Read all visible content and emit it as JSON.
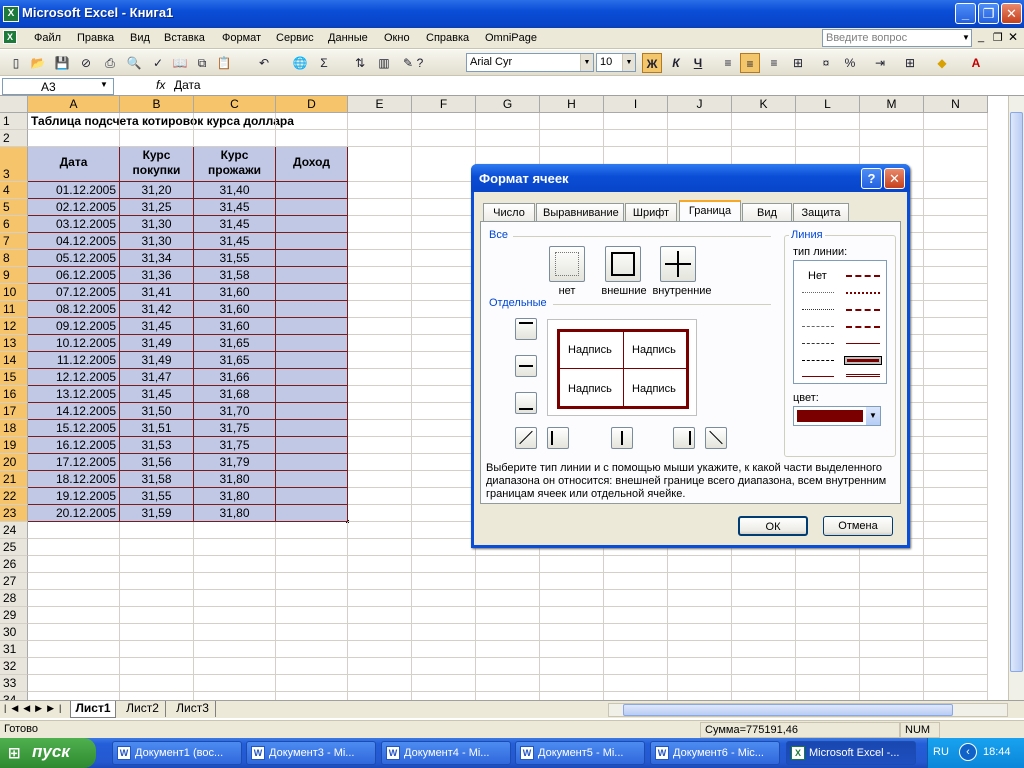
{
  "window": {
    "title": "Microsoft Excel - Книга1",
    "app_icon": "excel-icon"
  },
  "menu": {
    "items": [
      "Файл",
      "Правка",
      "Вид",
      "Вставка",
      "Формат",
      "Сервис",
      "Данные",
      "Окно",
      "Справка",
      "OmniPage"
    ],
    "ask_placeholder": "Введите вопрос"
  },
  "toolbar": {
    "font_name": "Arial Cyr",
    "font_size": "10",
    "bold_label": "Ж",
    "italic_label": "К",
    "underline_label": "Ч",
    "sum_label": "Σ",
    "percent_label": "%"
  },
  "formula_bar": {
    "name_box": "A3",
    "fx": "fx",
    "content": "Дата"
  },
  "columns": [
    "A",
    "B",
    "C",
    "D",
    "E",
    "F",
    "G",
    "H",
    "I",
    "J",
    "K",
    "L",
    "M",
    "N"
  ],
  "sheet": {
    "title_cell": "Таблица подсчета котировок курса доллара",
    "headers": [
      "Дата",
      "Курс покупки",
      "Курс прожажи",
      "Доход"
    ],
    "rows": [
      [
        "01.12.2005",
        "31,20",
        "31,40"
      ],
      [
        "02.12.2005",
        "31,25",
        "31,45"
      ],
      [
        "03.12.2005",
        "31,30",
        "31,45"
      ],
      [
        "04.12.2005",
        "31,30",
        "31,45"
      ],
      [
        "05.12.2005",
        "31,34",
        "31,55"
      ],
      [
        "06.12.2005",
        "31,36",
        "31,58"
      ],
      [
        "07.12.2005",
        "31,41",
        "31,60"
      ],
      [
        "08.12.2005",
        "31,42",
        "31,60"
      ],
      [
        "09.12.2005",
        "31,45",
        "31,60"
      ],
      [
        "10.12.2005",
        "31,49",
        "31,65"
      ],
      [
        "11.12.2005",
        "31,49",
        "31,65"
      ],
      [
        "12.12.2005",
        "31,47",
        "31,66"
      ],
      [
        "13.12.2005",
        "31,45",
        "31,68"
      ],
      [
        "14.12.2005",
        "31,50",
        "31,70"
      ],
      [
        "15.12.2005",
        "31,51",
        "31,75"
      ],
      [
        "16.12.2005",
        "31,53",
        "31,75"
      ],
      [
        "17.12.2005",
        "31,56",
        "31,79"
      ],
      [
        "18.12.2005",
        "31,58",
        "31,80"
      ],
      [
        "19.12.2005",
        "31,55",
        "31,80"
      ],
      [
        "20.12.2005",
        "31,59",
        "31,80"
      ]
    ],
    "row_numbers": [
      "1",
      "2",
      "3",
      "4",
      "5",
      "6",
      "7",
      "8",
      "9",
      "10",
      "11",
      "12",
      "13",
      "14",
      "15",
      "16",
      "17",
      "18",
      "19",
      "20",
      "21",
      "22",
      "23",
      "24",
      "25",
      "26",
      "27",
      "28",
      "29",
      "30",
      "31",
      "32",
      "33",
      "34"
    ]
  },
  "sheet_tabs": [
    "Лист1",
    "Лист2",
    "Лист3"
  ],
  "status": {
    "ready": "Готово",
    "sum": "Сумма=775191,46",
    "num": "NUM"
  },
  "taskbar": {
    "start": "пуск",
    "tasks": [
      "Документ1 (вос...",
      "Документ3 - Mi...",
      "Документ4 - Mi...",
      "Документ5 - Mi...",
      "Документ6 - Mic...",
      "Microsoft Excel -..."
    ],
    "lang": "RU",
    "time": "18:44"
  },
  "dialog": {
    "title": "Формат ячеек",
    "help": "?",
    "tabs": [
      "Число",
      "Выравнивание",
      "Шрифт",
      "Граница",
      "Вид",
      "Защита"
    ],
    "group_all": "Все",
    "preset_none": "нет",
    "preset_outline": "внешние",
    "preset_inside": "внутренние",
    "group_separate": "Отдельные",
    "preview_text": "Надпись",
    "group_line": "Линия",
    "line_type_label": "тип линии:",
    "line_none": "Нет",
    "color_label": "цвет:",
    "selected_color": "#7a0000",
    "hint": "Выберите тип линии и с помощью мыши укажите, к какой части выделенного диапазона он относится: внешней границе всего диапазона, всем внутренним границам ячеек или отдельной ячейке.",
    "ok": "ОК",
    "cancel": "Отмена"
  }
}
